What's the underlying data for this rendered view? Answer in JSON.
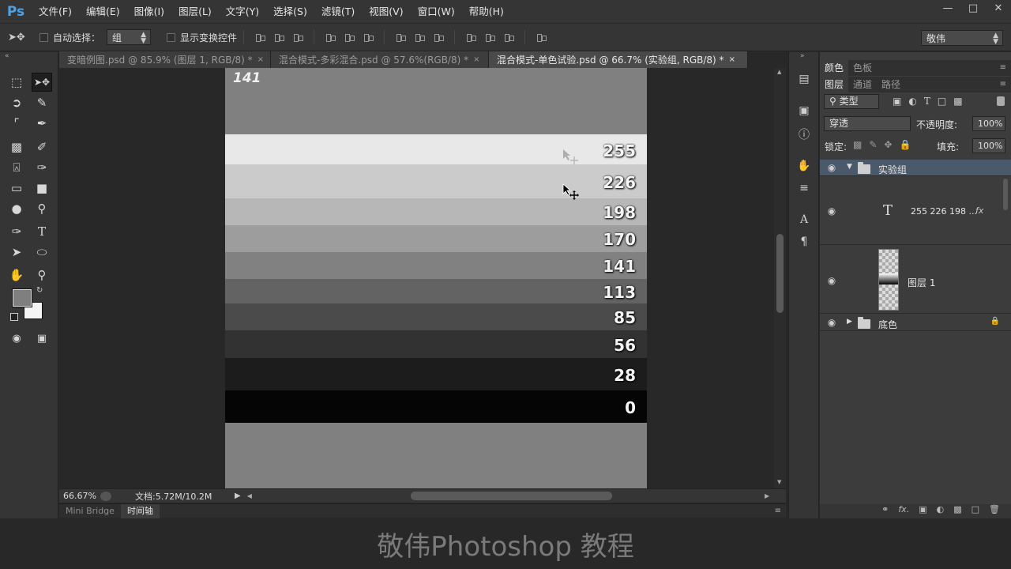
{
  "app": {
    "logo": "Ps"
  },
  "menu": [
    "文件(F)",
    "编辑(E)",
    "图像(I)",
    "图层(L)",
    "文字(Y)",
    "选择(S)",
    "滤镜(T)",
    "视图(V)",
    "窗口(W)",
    "帮助(H)"
  ],
  "options": {
    "auto_select_label": "自动选择：",
    "auto_select_value": "组",
    "show_transform_label": "显示变换控件",
    "workspace_value": "敬伟"
  },
  "tabs": [
    {
      "label": "变暗例图.psd @ 85.9% (图层 1, RGB/8) *",
      "close": "×"
    },
    {
      "label": "混合模式-多彩混合.psd @ 57.6%(RGB/8) *",
      "close": "×"
    },
    {
      "label": "混合模式-单色试验.psd @ 66.7% (实验组, RGB/8) *",
      "close": "×"
    }
  ],
  "canvas": {
    "top_label": "141",
    "bands": [
      {
        "label": "255",
        "color": "#e8e8e8"
      },
      {
        "label": "226",
        "color": "#cbcbcb"
      },
      {
        "label": "198",
        "color": "#b7b7b7"
      },
      {
        "label": "170",
        "color": "#9d9d9d"
      },
      {
        "label": "141",
        "color": "#818181"
      },
      {
        "label": "113",
        "color": "#636363"
      },
      {
        "label": "85",
        "color": "#4b4b4b"
      },
      {
        "label": "56",
        "color": "#323232"
      },
      {
        "label": "28",
        "color": "#1c1c1c"
      },
      {
        "label": "0",
        "color": "#050505"
      }
    ],
    "background": "#808080"
  },
  "status": {
    "zoom": "66.67%",
    "doc_info": "文档:5.72M/10.2M"
  },
  "bottom_tabs": [
    "Mini Bridge",
    "时间轴"
  ],
  "panels": {
    "top_tabs": [
      "颜色",
      "色板"
    ],
    "layer_tabs": [
      "图层",
      "通道",
      "路径"
    ],
    "filter_kind": "类型",
    "blend_mode": "穿透",
    "opacity_label": "不透明度:",
    "opacity_value": "100%",
    "lock_label": "锁定:",
    "fill_label": "填充:",
    "fill_value": "100%",
    "layers": [
      {
        "name": "实验组",
        "type": "group"
      },
      {
        "name": "255 226 198 ...",
        "type": "text",
        "fx": "fx"
      },
      {
        "name": "图层 1",
        "type": "pixel"
      },
      {
        "name": "底色",
        "type": "group"
      }
    ]
  },
  "watermark": "敬伟Photoshop 教程"
}
